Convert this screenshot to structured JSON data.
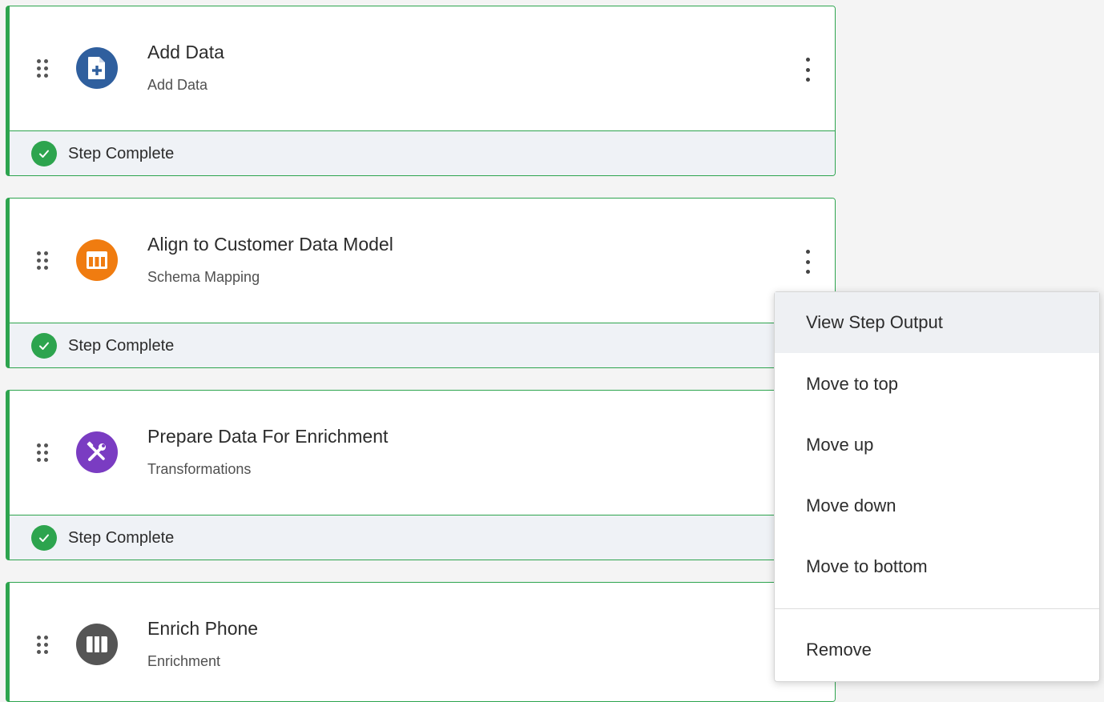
{
  "steps": [
    {
      "title": "Add Data",
      "subtitle": "Add Data",
      "status": "Step Complete",
      "icon": "file-plus-icon",
      "icon_color": "#2f5f9e"
    },
    {
      "title": "Align to Customer Data Model",
      "subtitle": "Schema Mapping",
      "status": "Step Complete",
      "icon": "table-icon",
      "icon_color": "#f07c10"
    },
    {
      "title": "Prepare Data For Enrichment",
      "subtitle": "Transformations",
      "status": "Step Complete",
      "icon": "tools-icon",
      "icon_color": "#7a3cc2"
    },
    {
      "title": "Enrich Phone",
      "subtitle": "Enrichment",
      "icon": "columns-icon",
      "icon_color": "#555555"
    }
  ],
  "context_menu": {
    "items": [
      "View Step Output",
      "Move to top",
      "Move up",
      "Move down",
      "Move to bottom"
    ],
    "remove_label": "Remove",
    "highlighted_item": "View Step Output"
  },
  "colors": {
    "complete_green": "#2da44e",
    "footer_bg": "#eff2f6"
  }
}
